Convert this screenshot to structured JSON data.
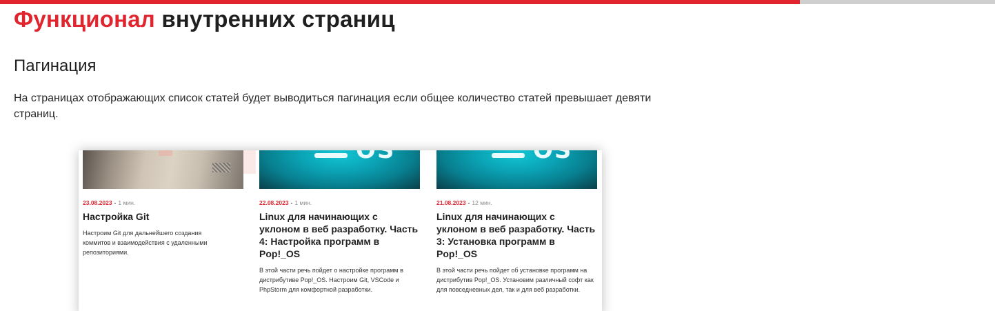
{
  "progress": {
    "fraction": 0.804,
    "fill_color": "#e0252f",
    "track_color": "#cfcfcf"
  },
  "header": {
    "title_accent": "Функционал",
    "title_rest": "внутренних страниц"
  },
  "section": {
    "title": "Пагинация",
    "paragraph": "На страницах отображающих список статей будет выводиться пагинация если общее количество статей превышает девяти страниц."
  },
  "cards": [
    {
      "date": "23.08.2023",
      "separator": "-",
      "read_time": "1 мин.",
      "title": "Настройка Git",
      "description": "Настроим Git для дальнейшего создания коммитов и взаимодействия с удаленными репозиториями.",
      "image": "paper-photo"
    },
    {
      "date": "22.08.2023",
      "separator": "-",
      "read_time": "1 мин.",
      "title": "Linux для начинающих с уклоном в веб разработку. Часть 4: Настройка программ в Pop!_OS",
      "description": "В этой части речь пойдет о настройке программ в дистрибутиве Pop!_OS. Настроим Git, VSCode и PhpStorm для комфортной разработки.",
      "image": "pop-os-teal"
    },
    {
      "date": "21.08.2023",
      "separator": "-",
      "read_time": "12 мин.",
      "title": "Linux для начинающих с уклоном в веб разработку. Часть 3: Установка программ в Pop!_OS",
      "description": "В этой части речь пойдет об установке программ на дистрибутив Pop!_OS. Установим различный софт как для повседневных дел, так и для веб разработки.",
      "image": "pop-os-teal"
    }
  ]
}
